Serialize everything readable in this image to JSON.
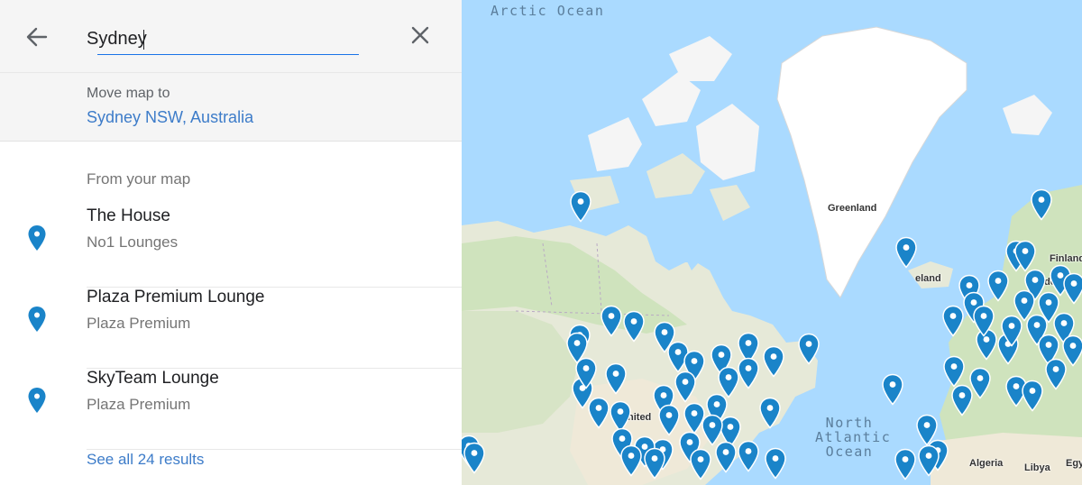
{
  "search": {
    "query": "Sydney",
    "back_icon": "arrow-left-icon",
    "clear_icon": "close-icon"
  },
  "move_map": {
    "label": "Move map to",
    "place": "Sydney NSW, Australia"
  },
  "from_map": {
    "label": "From your map",
    "results": [
      {
        "title": "The House",
        "subtitle": "No1 Lounges"
      },
      {
        "title": "Plaza Premium Lounge",
        "subtitle": "Plaza Premium"
      },
      {
        "title": "SkyTeam Lounge",
        "subtitle": "Plaza Premium"
      }
    ]
  },
  "see_all": "See all 24 results",
  "map": {
    "pin_color": "#1a84c9",
    "ocean_color": "#aadaff",
    "labels": {
      "arctic_ocean": "Arctic Ocean",
      "greenland": "Greenland",
      "iceland": "eland",
      "finland": "Finland",
      "sweden": "eder",
      "united": "nited",
      "north_atlantic_1": "North",
      "north_atlantic_2": "Atlantic",
      "north_atlantic_3": "Ocean",
      "algeria": "Algeria",
      "libya": "Libya",
      "egypt": "Egy"
    }
  }
}
